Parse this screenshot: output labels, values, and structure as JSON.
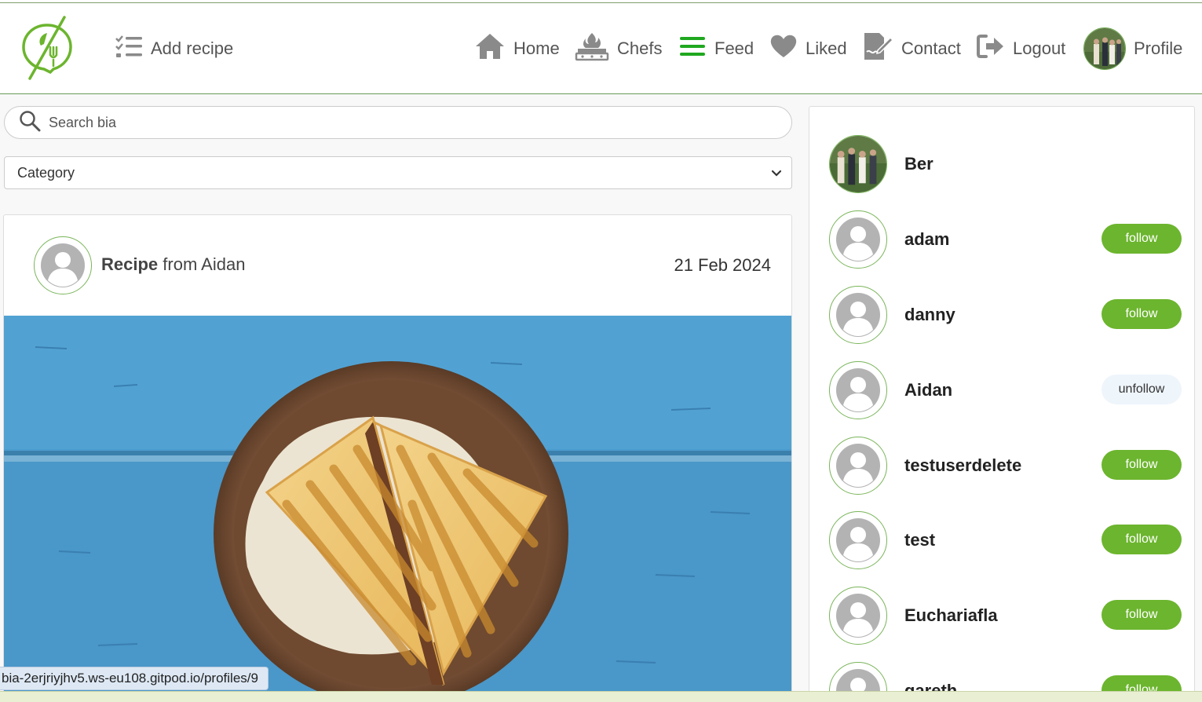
{
  "nav": {
    "add_recipe": "Add recipe",
    "home": "Home",
    "chefs": "Chefs",
    "feed": "Feed",
    "liked": "Liked",
    "contact": "Contact",
    "logout": "Logout",
    "profile": "Profile",
    "active": "Feed"
  },
  "colors": {
    "brand_green": "#6cb52e",
    "nav_icon_gray": "#8a8a8a",
    "feed_active": "#1fa81f",
    "page_bg": "#f8f8f8"
  },
  "search": {
    "placeholder": "Search bia"
  },
  "category": {
    "selected": "Category"
  },
  "post": {
    "prefix": "Recipe",
    "suffix": "from Aidan",
    "date": "21 Feb 2024"
  },
  "users": [
    {
      "name": "Ber",
      "button": ""
    },
    {
      "name": "adam",
      "button": "follow"
    },
    {
      "name": "danny",
      "button": "follow"
    },
    {
      "name": "Aidan",
      "button": "unfollow"
    },
    {
      "name": "testuserdelete",
      "button": "follow"
    },
    {
      "name": "test",
      "button": "follow"
    },
    {
      "name": "Euchariafla",
      "button": "follow"
    },
    {
      "name": "gareth",
      "button": "follow"
    }
  ],
  "status_bar": {
    "url": "bia-2erjriyjhv5.ws-eu108.gitpod.io/profiles/9"
  }
}
